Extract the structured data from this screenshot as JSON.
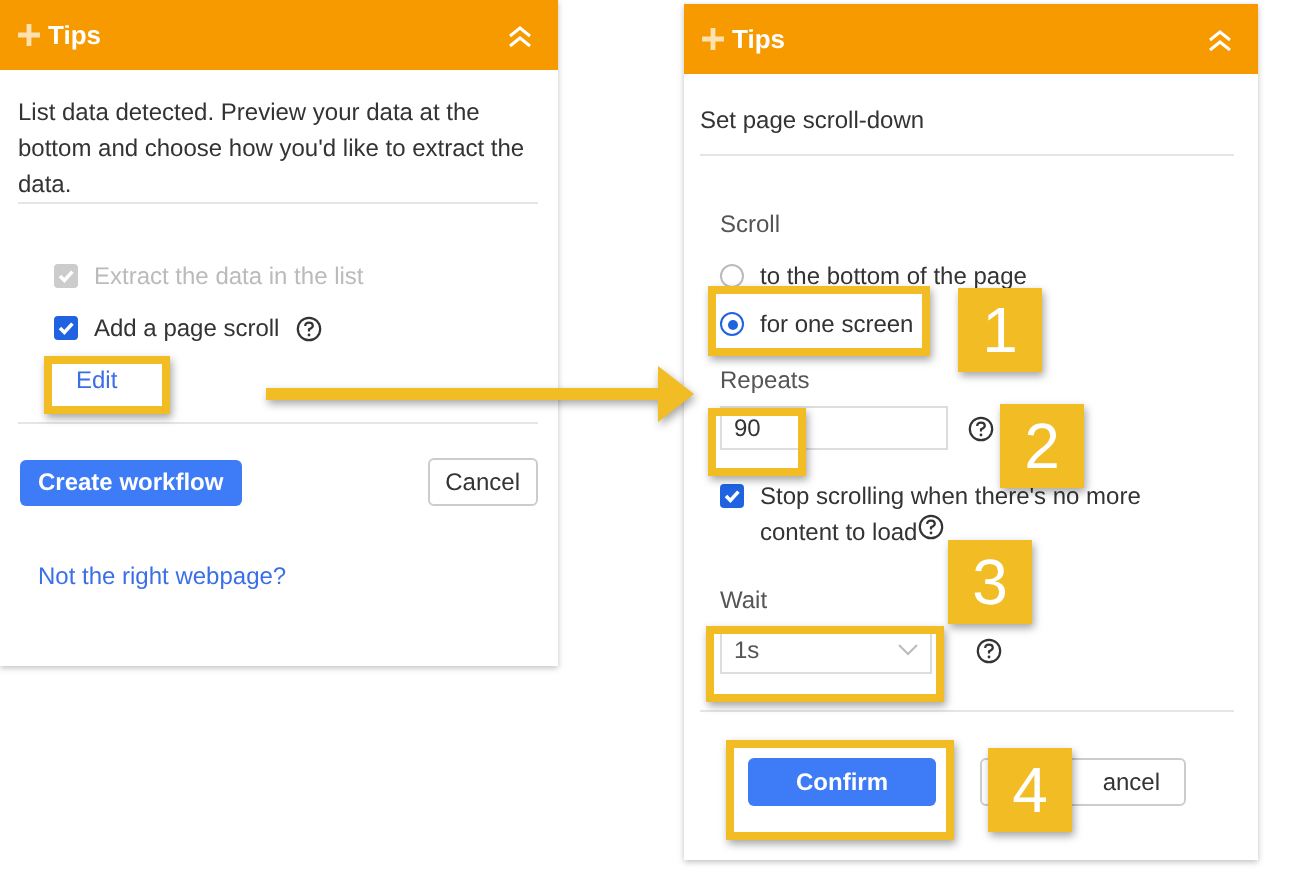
{
  "left_panel": {
    "title": "Tips",
    "description": "List data detected. Preview your data at the bottom and choose how you'd like to extract the data.",
    "options": [
      {
        "label": "Extract the data in the list",
        "checked": true,
        "disabled": true,
        "help": false
      },
      {
        "label": "Add a page scroll",
        "checked": true,
        "disabled": false,
        "help": true
      }
    ],
    "edit_link": "Edit",
    "primary_button": "Create workflow",
    "cancel_button": "Cancel",
    "link": "Not the right webpage?"
  },
  "right_panel": {
    "title": "Tips",
    "subtitle": "Set page scroll-down",
    "scroll_label": "Scroll",
    "scroll_options": [
      {
        "label": "to the bottom of the page",
        "selected": false
      },
      {
        "label": "for one screen",
        "selected": true
      }
    ],
    "repeats_label": "Repeats",
    "repeats_value": "90",
    "stop_option": {
      "label": "Stop scrolling when there's no more content to load",
      "checked": true
    },
    "wait_label": "Wait",
    "wait_value": "1s",
    "confirm_button": "Confirm",
    "cancel_button": "ancel"
  },
  "annotations": [
    "1",
    "2",
    "3",
    "4"
  ]
}
